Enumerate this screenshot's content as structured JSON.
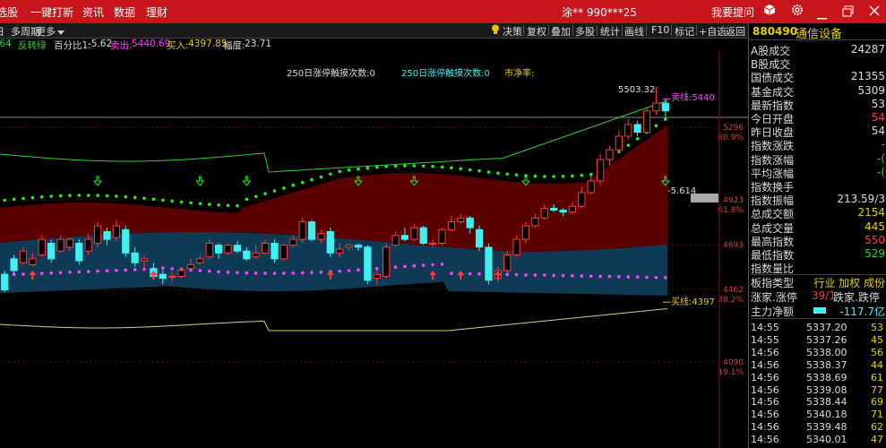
{
  "topbar": {
    "menu": [
      "选股",
      "一键打新",
      "资讯",
      "数据",
      "理财"
    ],
    "account": "涂** 990***25",
    "right_item": "我要提问"
  },
  "toolbar": {
    "left": [
      "日",
      "多周期",
      "更多"
    ],
    "right": [
      "决策",
      "复权",
      "叠加",
      "多股",
      "统计",
      "画线",
      "F10",
      "标记",
      "+自选",
      "返回"
    ]
  },
  "indicator": {
    "first": ".64",
    "name": "反转绿",
    "pct_label": "百分比1:",
    "pct_value": "-5.62",
    "sell_label": "卖出:",
    "sell_value": "5440.69",
    "buy_label": "买入:",
    "buy_value": "4397.85",
    "range_label": "幅度:",
    "range_value": "23.71"
  },
  "chart_annotations": {
    "limit_up_count": "250日涨停触摸次数:0",
    "limit_down_count": "250日涨停触摸次数:0",
    "pe": "市净率:",
    "high_label": "5503.32",
    "sell_line": "卖线:5440",
    "buy_line": "买线:4397",
    "neg_label": "-5.614"
  },
  "axis": {
    "labels": [
      {
        "value": "5296",
        "pct": "80.9%"
      },
      {
        "value": "4923",
        "pct": "61.8%"
      },
      {
        "value": "4693",
        "pct": ""
      },
      {
        "value": "4462",
        "pct": "38.2%"
      },
      {
        "value": "4090",
        "pct": "19.1%"
      }
    ]
  },
  "chart_data": {
    "type": "candlestick",
    "candles": [
      [
        4540,
        4460,
        4560,
        4450
      ],
      [
        4620,
        4560,
        4640,
        4540
      ],
      [
        4600,
        4660,
        4680,
        4590
      ],
      [
        4590,
        4620,
        4650,
        4580
      ],
      [
        4640,
        4720,
        4740,
        4630
      ],
      [
        4700,
        4620,
        4720,
        4600
      ],
      [
        4660,
        4720,
        4740,
        4650
      ],
      [
        4680,
        4720,
        4730,
        4660
      ],
      [
        4700,
        4610,
        4720,
        4590
      ],
      [
        4660,
        4720,
        4750,
        4640
      ],
      [
        4700,
        4790,
        4810,
        4680
      ],
      [
        4760,
        4720,
        4780,
        4690
      ],
      [
        4730,
        4790,
        4820,
        4710
      ],
      [
        4770,
        4650,
        4790,
        4630
      ],
      [
        4650,
        4600,
        4680,
        4580
      ],
      [
        4610,
        4620,
        4640,
        4560
      ],
      [
        4570,
        4530,
        4600,
        4520
      ],
      [
        4540,
        4520,
        4560,
        4490
      ],
      [
        4530,
        4530,
        4550,
        4500
      ],
      [
        4530,
        4560,
        4580,
        4520
      ],
      [
        4570,
        4590,
        4620,
        4560
      ],
      [
        4600,
        4620,
        4640,
        4590
      ],
      [
        4630,
        4700,
        4720,
        4620
      ],
      [
        4690,
        4650,
        4700,
        4620
      ],
      [
        4650,
        4690,
        4700,
        4640
      ],
      [
        4690,
        4660,
        4710,
        4650
      ],
      [
        4660,
        4620,
        4680,
        4610
      ],
      [
        4630,
        4650,
        4690,
        4620
      ],
      [
        4650,
        4700,
        4720,
        4640
      ],
      [
        4700,
        4620,
        4720,
        4600
      ],
      [
        4620,
        4690,
        4700,
        4610
      ],
      [
        4690,
        4720,
        4740,
        4680
      ],
      [
        4720,
        4810,
        4830,
        4700
      ],
      [
        4810,
        4720,
        4820,
        4710
      ],
      [
        4720,
        4750,
        4770,
        4700
      ],
      [
        4760,
        4650,
        4780,
        4630
      ],
      [
        4650,
        4670,
        4700,
        4630
      ],
      [
        4680,
        4690,
        4700,
        4660
      ],
      [
        4690,
        4680,
        4700,
        4660
      ],
      [
        4680,
        4510,
        4690,
        4490
      ],
      [
        4520,
        4540,
        4560,
        4490
      ],
      [
        4530,
        4680,
        4700,
        4520
      ],
      [
        4690,
        4740,
        4760,
        4680
      ],
      [
        4740,
        4720,
        4780,
        4710
      ],
      [
        4720,
        4780,
        4800,
        4710
      ],
      [
        4780,
        4700,
        4790,
        4690
      ],
      [
        4700,
        4700,
        4720,
        4680
      ],
      [
        4700,
        4770,
        4780,
        4690
      ],
      [
        4770,
        4810,
        4840,
        4760
      ],
      [
        4810,
        4830,
        4850,
        4800
      ],
      [
        4830,
        4780,
        4840,
        4750
      ],
      [
        4770,
        4680,
        4790,
        4660
      ],
      [
        4680,
        4510,
        4700,
        4490
      ],
      [
        4520,
        4560,
        4580,
        4500
      ],
      [
        4560,
        4640,
        4660,
        4550
      ],
      [
        4640,
        4720,
        4740,
        4630
      ],
      [
        4720,
        4790,
        4810,
        4700
      ],
      [
        4790,
        4830,
        4850,
        4780
      ],
      [
        4830,
        4880,
        4900,
        4820
      ],
      [
        4880,
        4870,
        4900,
        4860
      ],
      [
        4870,
        4860,
        4880,
        4840
      ],
      [
        4860,
        4890,
        4910,
        4850
      ],
      [
        4890,
        4960,
        4990,
        4880
      ],
      [
        4960,
        5020,
        5050,
        4950
      ],
      [
        5020,
        5130,
        5160,
        5000
      ],
      [
        5130,
        5180,
        5200,
        5100
      ],
      [
        5180,
        5250,
        5280,
        5160
      ],
      [
        5250,
        5310,
        5340,
        5230
      ],
      [
        5310,
        5270,
        5330,
        5250
      ],
      [
        5270,
        5380,
        5400,
        5260
      ],
      [
        5380,
        5420,
        5503,
        5360
      ],
      [
        5420,
        5380,
        5440,
        5350
      ]
    ]
  },
  "right_panel": {
    "code": "880490",
    "name": "通信设备",
    "stats": [
      {
        "label": "A股成交",
        "value": "24287",
        "color": "#ddd"
      },
      {
        "label": "B股成交",
        "value": "",
        "color": "#ddd"
      },
      {
        "label": "国债成交",
        "value": "21355",
        "color": "#ddd"
      },
      {
        "label": "基金成交",
        "value": "5309",
        "color": "#ddd"
      },
      {
        "label": "最新指数",
        "value": "53",
        "color": "#ddd"
      },
      {
        "label": "今日开盘",
        "value": "54",
        "color": "#ff3b3b"
      },
      {
        "label": "昨日收盘",
        "value": "54",
        "color": "#ddd"
      },
      {
        "label": "指数涨跌",
        "value": "-",
        "color": "#2fd12f"
      },
      {
        "label": "指数涨幅",
        "value": "-(",
        "color": "#2fd12f"
      },
      {
        "label": "平均涨幅",
        "value": "-(",
        "color": "#2fd12f"
      },
      {
        "label": "指数换手",
        "value": "",
        "color": "#ddd"
      },
      {
        "label": "指数振幅",
        "value": "213.59/3",
        "color": "#ddd"
      },
      {
        "label": "总成交额",
        "value": "2154",
        "color": "#e8d000"
      },
      {
        "label": "总成交量",
        "value": "445",
        "color": "#e8d000"
      },
      {
        "label": "最高指数",
        "value": "550",
        "color": "#ff3b3b"
      },
      {
        "label": "最低指数",
        "value": "529",
        "color": "#2fd12f"
      },
      {
        "label": "指数量比",
        "value": "",
        "color": "#ddd"
      }
    ],
    "sector_label": "板指类型",
    "sector_value": "行业 加权 成份",
    "updown_label": "涨家.涨停",
    "updown_value": "39/1",
    "down_label": "跌家.跌停",
    "netflow_label": "主力净额",
    "netflow_value": "-117.7亿",
    "ticks": [
      {
        "time": "14:55",
        "price": "5337.20",
        "vol": "53"
      },
      {
        "time": "14:55",
        "price": "5337.26",
        "vol": "45"
      },
      {
        "time": "14:56",
        "price": "5338.00",
        "vol": "56"
      },
      {
        "time": "14:56",
        "price": "5338.37",
        "vol": "44"
      },
      {
        "time": "14:56",
        "price": "5338.69",
        "vol": "61"
      },
      {
        "time": "14:56",
        "price": "5339.08",
        "vol": "77"
      },
      {
        "time": "14:56",
        "price": "5338.44",
        "vol": "69"
      },
      {
        "time": "14:56",
        "price": "5340.18",
        "vol": "71"
      },
      {
        "time": "14:56",
        "price": "5339.48",
        "vol": "62"
      },
      {
        "time": "14:56",
        "price": "5340.01",
        "vol": "47"
      }
    ]
  },
  "colors": {
    "up": "#ff3b3b",
    "down": "#3ef0f0",
    "upper_band": "#5a0000",
    "lower_band": "#0f3a55",
    "green_dot": "#22ee22",
    "magenta_dot": "#ff44ff"
  }
}
